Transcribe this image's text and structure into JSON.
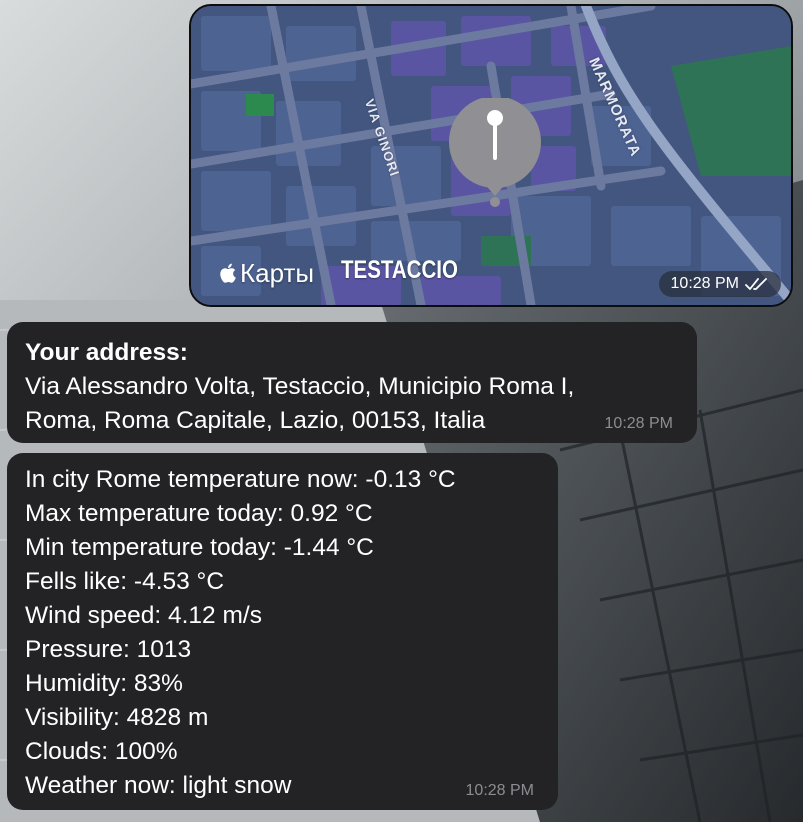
{
  "map_message": {
    "brand_label": "Карты",
    "district_label": "TESTACCIO",
    "street_labels": [
      "VIA GINORI",
      "MARMORATA"
    ],
    "time": "10:28 PM",
    "status_icon": "double-check-icon"
  },
  "address_message": {
    "heading": "Your address:",
    "lines": [
      "Via Alessandro Volta, Testaccio, Municipio Roma I,",
      "Roma, Roma Capitale, Lazio, 00153, Italia"
    ],
    "time": "10:28 PM"
  },
  "weather_message": {
    "lines": [
      "In city Rome temperature now: -0.13 °C",
      "Max temperature today: 0.92 °C",
      "Min temperature today: -1.44 °C",
      "Fells like: -4.53 °C",
      "Wind speed: 4.12 m/s",
      "Pressure: 1013",
      "Humidity: 83%",
      "Visibility: 4828 m",
      "Clouds: 100%",
      "Weather now: light snow"
    ],
    "time": "10:28 PM"
  },
  "colors": {
    "bubble_bg": "#232325",
    "map_block": "#4a5f8e",
    "map_purple": "#5c54a0",
    "map_green": "#2f7356",
    "pin": "#8f8f94"
  }
}
